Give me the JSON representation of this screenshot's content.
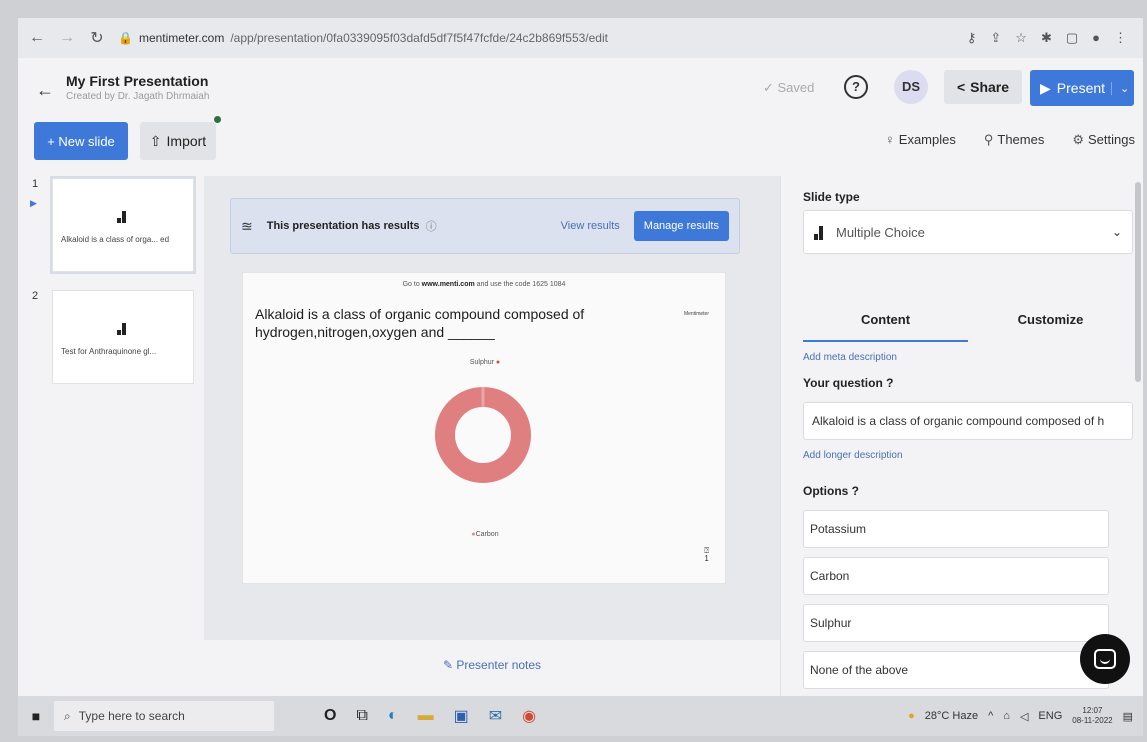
{
  "browser": {
    "url_domain": "mentimeter.com",
    "url_path": "/app/presentation/0fa0339095f03dafd5df7f5f47fcfde/24c2b869f553/edit"
  },
  "header": {
    "title": "My First Presentation",
    "subtitle": "Created by Dr. Jagath Dhrmaiah",
    "saved_label": "Saved",
    "avatar_initials": "DS",
    "share_label": "Share",
    "present_label": "Present"
  },
  "toolbar": {
    "new_slide_label": "+ New slide",
    "import_label": "Import",
    "examples_label": "Examples",
    "themes_label": "Themes",
    "settings_label": "Settings"
  },
  "slides": [
    {
      "number": "1",
      "text": "Alkaloid is a class of orga... ed"
    },
    {
      "number": "2",
      "text": "Test for Anthraquinone gl..."
    }
  ],
  "editor": {
    "results_banner": "This presentation has results",
    "view_results": "View results",
    "manage_results": "Manage results",
    "go_to_prefix": "Go to",
    "go_to_site": "www.menti.com",
    "go_to_suffix": "and use the code 1625 1084",
    "brand_mark": "Mentimeter",
    "question": "Alkaloid is a class of organic compound composed of hydrogen,nitrogen,oxygen and ______",
    "label_top": "Sulphur",
    "label_bottom": "Carbon",
    "presenter_notes": "Presenter notes"
  },
  "chart_data": {
    "type": "pie",
    "categories": [
      "Sulphur",
      "Carbon"
    ],
    "colors": [
      "#e07f80",
      "#e89aa0"
    ]
  },
  "panel": {
    "slide_type_label": "Slide type",
    "slide_type_value": "Multiple Choice",
    "tab_content": "Content",
    "tab_customize": "Customize",
    "add_meta": "Add meta description",
    "your_question_label": "Your question ?",
    "question_value": "Alkaloid is a class of organic compound composed of h",
    "add_longer": "Add longer description",
    "options_label": "Options ?",
    "options": [
      "Potassium",
      "Carbon",
      "Sulphur",
      "None of the above"
    ]
  },
  "taskbar": {
    "search_placeholder": "Type here to search",
    "weather": "28°C Haze",
    "lang": "ENG",
    "time": "12:07",
    "date": "08-11-2022"
  }
}
